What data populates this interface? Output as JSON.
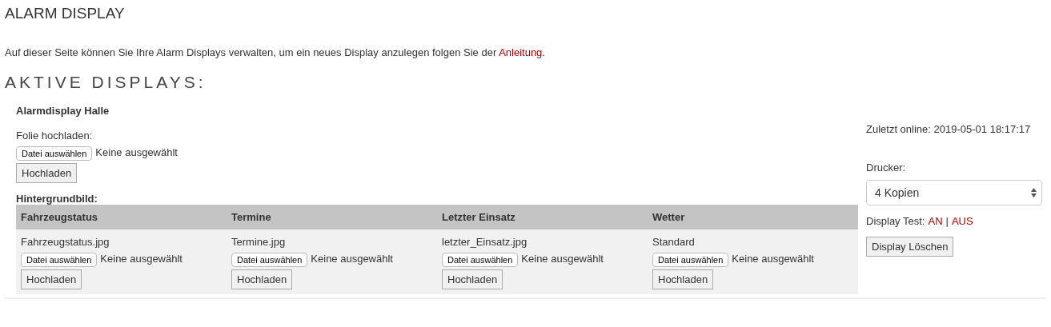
{
  "page_title": "ALARM DISPLAY",
  "intro": {
    "text": "Auf dieser Seite können Sie Ihre Alarm Displays verwalten, um ein neues Display anzulegen folgen Sie der ",
    "link": "Anleitung",
    "after": "."
  },
  "section_title": "AKTIVE DISPLAYS:",
  "display": {
    "name": "Alarmdisplay Halle",
    "slide_label": "Folie hochladen:",
    "slide_file": {
      "choose": "Datei auswählen",
      "status": "Keine ausgewählt",
      "upload": "Hochladen"
    },
    "background_label": "Hintergrundbild:",
    "backgrounds": [
      {
        "heading": "Fahrzeugstatus",
        "current": "Fahrzeugstatus.jpg",
        "choose": "Datei auswählen",
        "status": "Keine ausgewählt",
        "upload": "Hochladen"
      },
      {
        "heading": "Termine",
        "current": "Termine.jpg",
        "choose": "Datei auswählen",
        "status": "Keine ausgewählt",
        "upload": "Hochladen"
      },
      {
        "heading": "Letzter Einsatz",
        "current": "letzter_Einsatz.jpg",
        "choose": "Datei auswählen",
        "status": "Keine ausgewählt",
        "upload": "Hochladen"
      },
      {
        "heading": "Wetter",
        "current": "Standard",
        "choose": "Datei auswählen",
        "status": "Keine ausgewählt",
        "upload": "Hochladen"
      }
    ],
    "last_online": "Zuletzt online: 2019-05-01 18:17:17",
    "printer_label": "Drucker:",
    "printer_value": "4 Kopien",
    "test_label": "Display Test:",
    "test_on": "AN",
    "test_separator": "|",
    "test_off": "AUS",
    "delete": "Display Löschen"
  }
}
